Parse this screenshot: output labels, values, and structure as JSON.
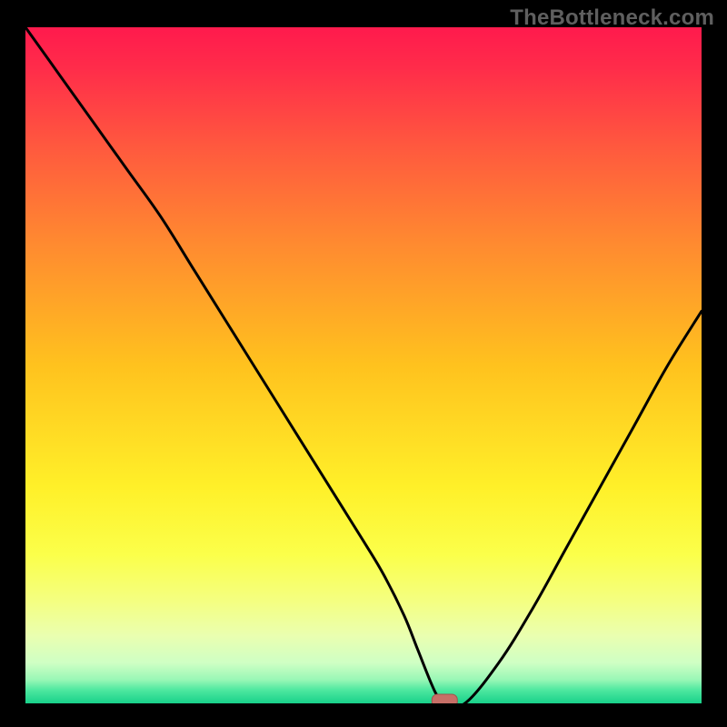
{
  "watermark": "TheBottleneck.com",
  "colors": {
    "background": "#000000",
    "watermark": "#5f5f5f",
    "curve": "#000000",
    "marker_fill": "#c76f67",
    "marker_stroke": "#a0534d",
    "gradient_stops": [
      {
        "offset": "0%",
        "color": "#ff1a4d"
      },
      {
        "offset": "6%",
        "color": "#ff2c4a"
      },
      {
        "offset": "18%",
        "color": "#ff5a3e"
      },
      {
        "offset": "32%",
        "color": "#ff8a30"
      },
      {
        "offset": "50%",
        "color": "#ffc21e"
      },
      {
        "offset": "68%",
        "color": "#fff029"
      },
      {
        "offset": "78%",
        "color": "#fbff4a"
      },
      {
        "offset": "85%",
        "color": "#f4ff82"
      },
      {
        "offset": "90%",
        "color": "#eaffb0"
      },
      {
        "offset": "94%",
        "color": "#cfffc4"
      },
      {
        "offset": "96.5%",
        "color": "#99f7b6"
      },
      {
        "offset": "98%",
        "color": "#4fe8a0"
      },
      {
        "offset": "100%",
        "color": "#18d18a"
      }
    ]
  },
  "chart_data": {
    "type": "line",
    "title": "",
    "xlabel": "",
    "ylabel": "",
    "xlim": [
      0,
      100
    ],
    "ylim": [
      0,
      100
    ],
    "series": [
      {
        "name": "bottleneck-curve",
        "x": [
          0,
          5,
          10,
          15,
          20,
          25,
          30,
          35,
          40,
          45,
          50,
          53,
          56,
          58,
          60,
          61,
          62,
          65,
          70,
          75,
          80,
          85,
          90,
          95,
          100
        ],
        "y": [
          100,
          93,
          86,
          79,
          72,
          64,
          56,
          48,
          40,
          32,
          24,
          19,
          13,
          8,
          3,
          1,
          0,
          0,
          6,
          14,
          23,
          32,
          41,
          50,
          58
        ]
      }
    ],
    "marker": {
      "x": 62,
      "y": 0
    },
    "gradient_axis": "y",
    "gradient_meaning": "value scale from 0 (green, bottom) to 100 (red, top)"
  }
}
